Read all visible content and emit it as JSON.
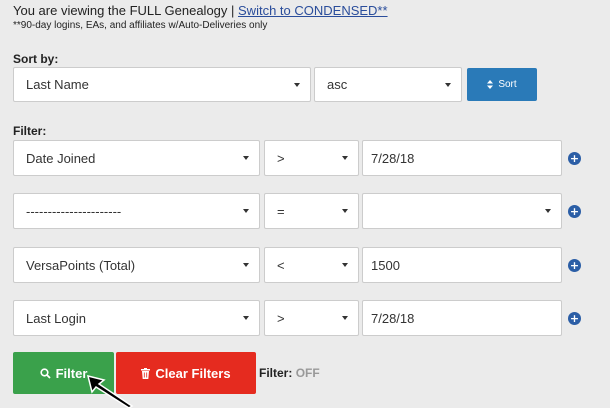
{
  "header": {
    "notice_prefix": "You are viewing the FULL Genealogy |",
    "switch_link": "Switch to CONDENSED**",
    "footnote": "**90-day logins, EAs, and affiliates w/Auto-Deliveries only"
  },
  "sort": {
    "label": "Sort by:",
    "field": "Last Name",
    "direction": "asc",
    "button_label": "Sort"
  },
  "filter": {
    "label": "Filter:",
    "rows": [
      {
        "field": "Date Joined",
        "operator": ">",
        "value": "7/28/18",
        "value_type": "text"
      },
      {
        "field": "----------------------",
        "operator": "=",
        "value": "",
        "value_type": "select"
      },
      {
        "field": "VersaPoints (Total)",
        "operator": "<",
        "value": "1500",
        "value_type": "text"
      },
      {
        "field": "Last Login",
        "operator": ">",
        "value": "7/28/18",
        "value_type": "text"
      }
    ]
  },
  "actions": {
    "filter_button": "Filter",
    "clear_button": "Clear Filters",
    "status_label": "Filter:",
    "status_value": "OFF"
  },
  "colors": {
    "link": "#2a4d9b",
    "sort_button": "#2a7ab8",
    "filter_button": "#3aa14b",
    "clear_button": "#e52b1f",
    "plus_icon": "#2b5ea6"
  }
}
